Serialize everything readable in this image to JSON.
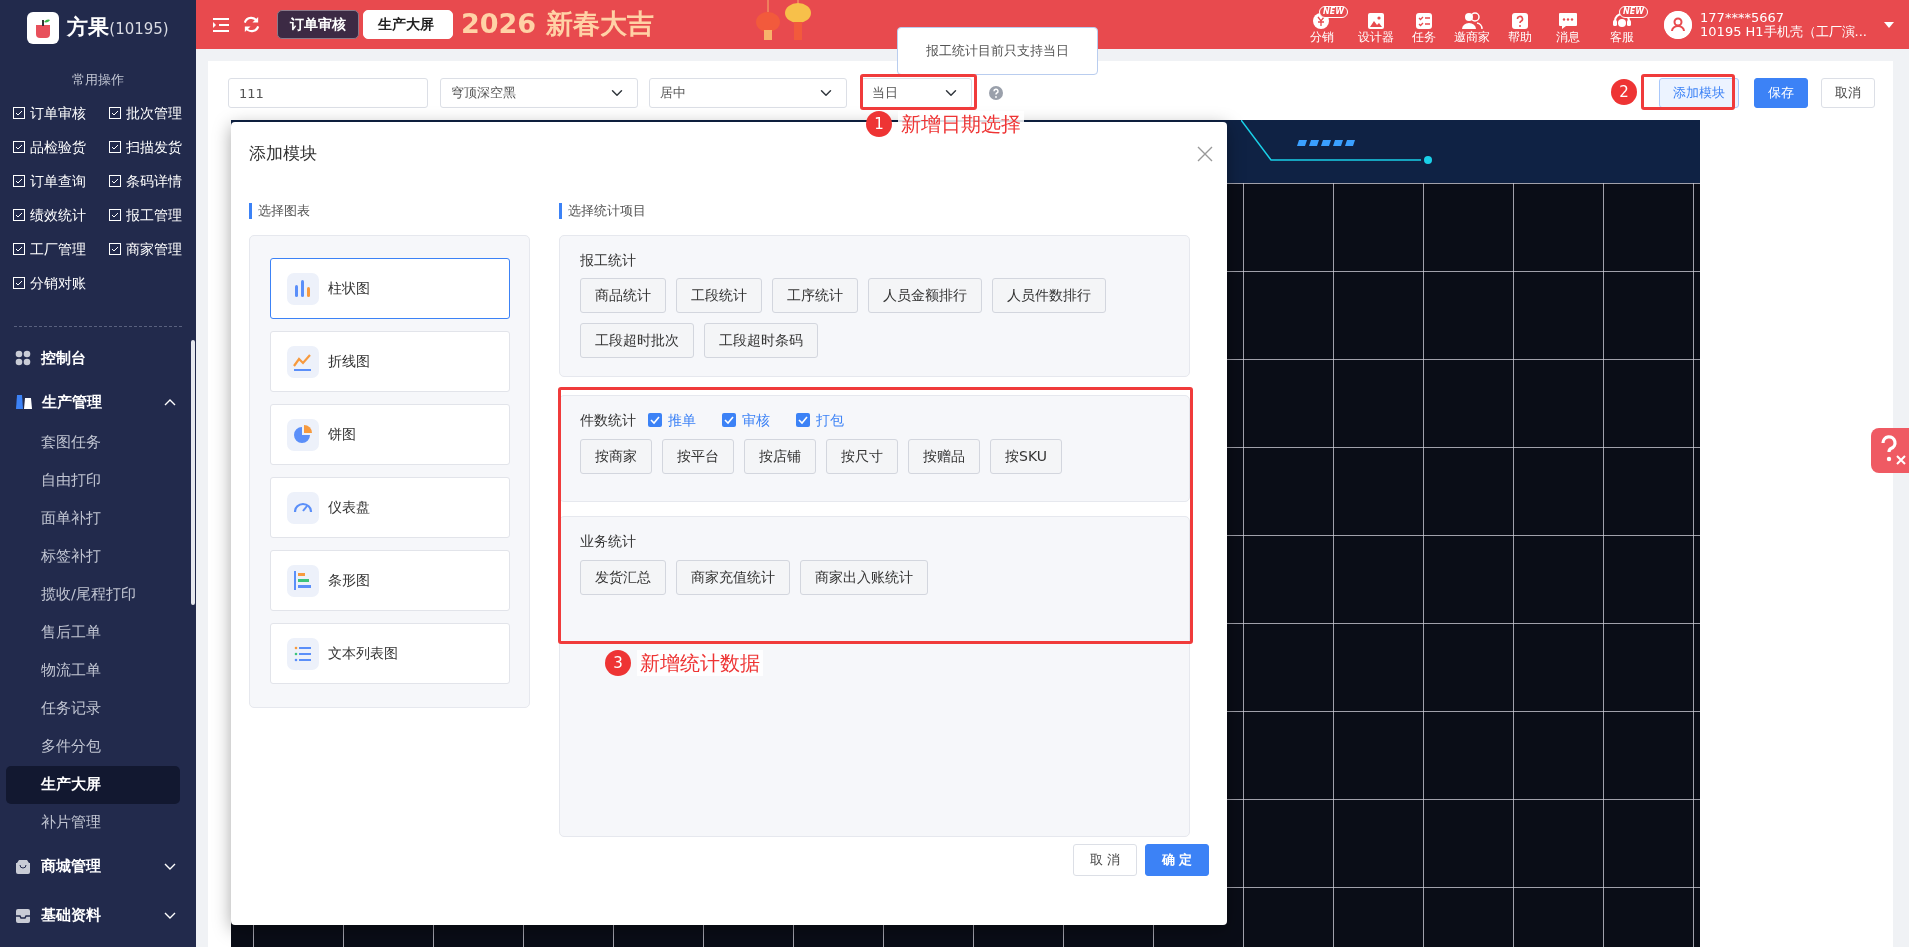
{
  "sidebar": {
    "logo": {
      "name": "方果",
      "code": "(10195)"
    },
    "quick_title": "常用操作",
    "quick_actions": [
      {
        "label": "订单审核"
      },
      {
        "label": "批次管理"
      },
      {
        "label": "品检验货"
      },
      {
        "label": "扫描发货"
      },
      {
        "label": "订单查询"
      },
      {
        "label": "条码详情"
      },
      {
        "label": "绩效统计"
      },
      {
        "label": "报工管理"
      },
      {
        "label": "工厂管理"
      },
      {
        "label": "商家管理"
      },
      {
        "label": "分销对账"
      }
    ],
    "menu": [
      {
        "label": "控制台"
      },
      {
        "label": "生产管理",
        "expanded": true,
        "children": [
          {
            "label": "套图任务",
            "selected": false
          },
          {
            "label": "自由打印",
            "selected": false
          },
          {
            "label": "面单补打",
            "selected": false
          },
          {
            "label": "标签补打",
            "selected": false
          },
          {
            "label": "揽收/尾程打印",
            "selected": false
          },
          {
            "label": "售后工单",
            "selected": false
          },
          {
            "label": "物流工单",
            "selected": false
          },
          {
            "label": "任务记录",
            "selected": false
          },
          {
            "label": "多件分包",
            "selected": false
          },
          {
            "label": "生产大屏",
            "selected": true
          },
          {
            "label": "补片管理",
            "selected": false
          }
        ]
      },
      {
        "label": "商城管理",
        "expanded": false
      },
      {
        "label": "基础资料",
        "expanded": false
      }
    ]
  },
  "topbar": {
    "tabs": [
      {
        "label": "订单审核",
        "selected": false
      },
      {
        "label": "生产大屏",
        "selected": true
      }
    ],
    "banner": "2026 新春大吉",
    "tools": [
      {
        "label": "分销",
        "badge": "NEW"
      },
      {
        "label": "设计器"
      },
      {
        "label": "任务"
      },
      {
        "label": "邀商家"
      },
      {
        "label": "帮助"
      },
      {
        "label": "消息"
      },
      {
        "label": "客服",
        "badge": "NEW"
      }
    ],
    "user": {
      "phone": "177****5667",
      "org": "10195 H1手机壳（工厂演..."
    }
  },
  "toolbar": {
    "fields": [
      {
        "kind": "input",
        "value": "111"
      },
      {
        "kind": "select",
        "value": "穹顶深空黑"
      },
      {
        "kind": "select",
        "value": "居中"
      },
      {
        "kind": "select",
        "value": "当日"
      }
    ],
    "tooltip": "报工统计目前只支持当日",
    "buttons": [
      {
        "label": "添加模块",
        "kind": "outline"
      },
      {
        "label": "保存",
        "kind": "primary"
      },
      {
        "label": "取消",
        "kind": "default"
      }
    ]
  },
  "annotations": [
    {
      "number": "1",
      "text": "新增日期选择"
    },
    {
      "number": "2"
    },
    {
      "number": "3",
      "text": "新增统计数据"
    }
  ],
  "dialog": {
    "title": "添加模块",
    "chart_section": {
      "title": "选择图表",
      "items": [
        {
          "label": "柱状图",
          "selected": true
        },
        {
          "label": "折线图",
          "selected": false
        },
        {
          "label": "饼图",
          "selected": false
        },
        {
          "label": "仪表盘",
          "selected": false
        },
        {
          "label": "条形图",
          "selected": false
        },
        {
          "label": "文本列表图",
          "selected": false
        }
      ]
    },
    "stats_section": {
      "title": "选择统计项目",
      "groups": [
        {
          "title": "报工统计",
          "options": [
            "商品统计",
            "工段统计",
            "工序统计",
            "人员金额排行",
            "人员件数排行",
            "工段超时批次",
            "工段超时条码"
          ]
        },
        {
          "title": "件数统计",
          "filters": [
            {
              "label": "推单",
              "checked": true
            },
            {
              "label": "审核",
              "checked": true
            },
            {
              "label": "打包",
              "checked": true
            }
          ],
          "options": [
            "按商家",
            "按平台",
            "按店铺",
            "按尺寸",
            "按赠品",
            "按SKU"
          ]
        },
        {
          "title": "业务统计",
          "options": [
            "发货汇总",
            "商家充值统计",
            "商家出入账统计"
          ]
        }
      ]
    },
    "buttons": [
      {
        "label": "取 消",
        "kind": "default"
      },
      {
        "label": "确 定",
        "kind": "primary"
      }
    ]
  }
}
